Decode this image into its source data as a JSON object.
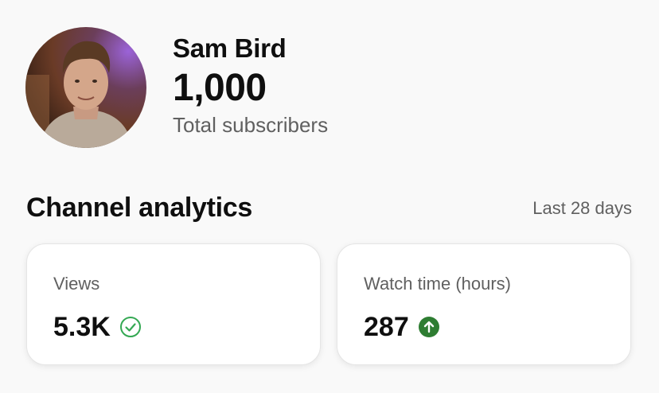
{
  "channel": {
    "name": "Sam Bird",
    "subscriber_count": "1,000",
    "subscriber_label": "Total subscribers"
  },
  "analytics": {
    "title": "Channel analytics",
    "range": "Last 28 days",
    "cards": [
      {
        "label": "Views",
        "value": "5.3K",
        "icon": "check-circle-icon"
      },
      {
        "label": "Watch time (hours)",
        "value": "287",
        "icon": "arrow-up-circle-icon"
      }
    ]
  },
  "colors": {
    "check": "#34a853",
    "up": "#2e7d32",
    "secondary_text": "#606060"
  }
}
